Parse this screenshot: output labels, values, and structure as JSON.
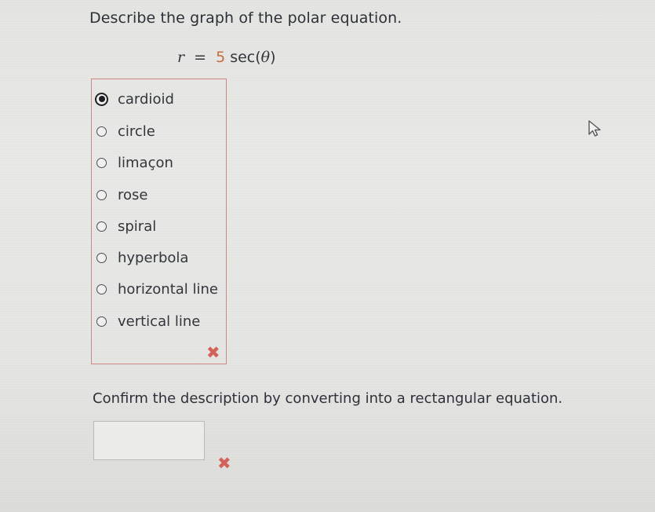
{
  "question": {
    "prompt": "Describe the graph of the polar equation.",
    "equation": {
      "lhs": "r",
      "equals": "=",
      "coefficient": "5",
      "function": "sec(",
      "variable": "θ",
      "close": ")"
    }
  },
  "choices": [
    {
      "label": "cardioid",
      "selected": true
    },
    {
      "label": "circle",
      "selected": false
    },
    {
      "label": "limaçon",
      "selected": false
    },
    {
      "label": "rose",
      "selected": false
    },
    {
      "label": "spiral",
      "selected": false
    },
    {
      "label": "hyperbola",
      "selected": false
    },
    {
      "label": "horizontal line",
      "selected": false
    },
    {
      "label": "vertical line",
      "selected": false
    }
  ],
  "feedback": {
    "choice_mark": "✖",
    "answer_mark": "✖",
    "mark_color": "#d5625a"
  },
  "part2": {
    "instruction": "Confirm the description by converting into a rectangular equation.",
    "answer_value": ""
  },
  "icons": {
    "incorrect": "x-mark-icon",
    "pointer": "mouse-cursor-icon"
  }
}
